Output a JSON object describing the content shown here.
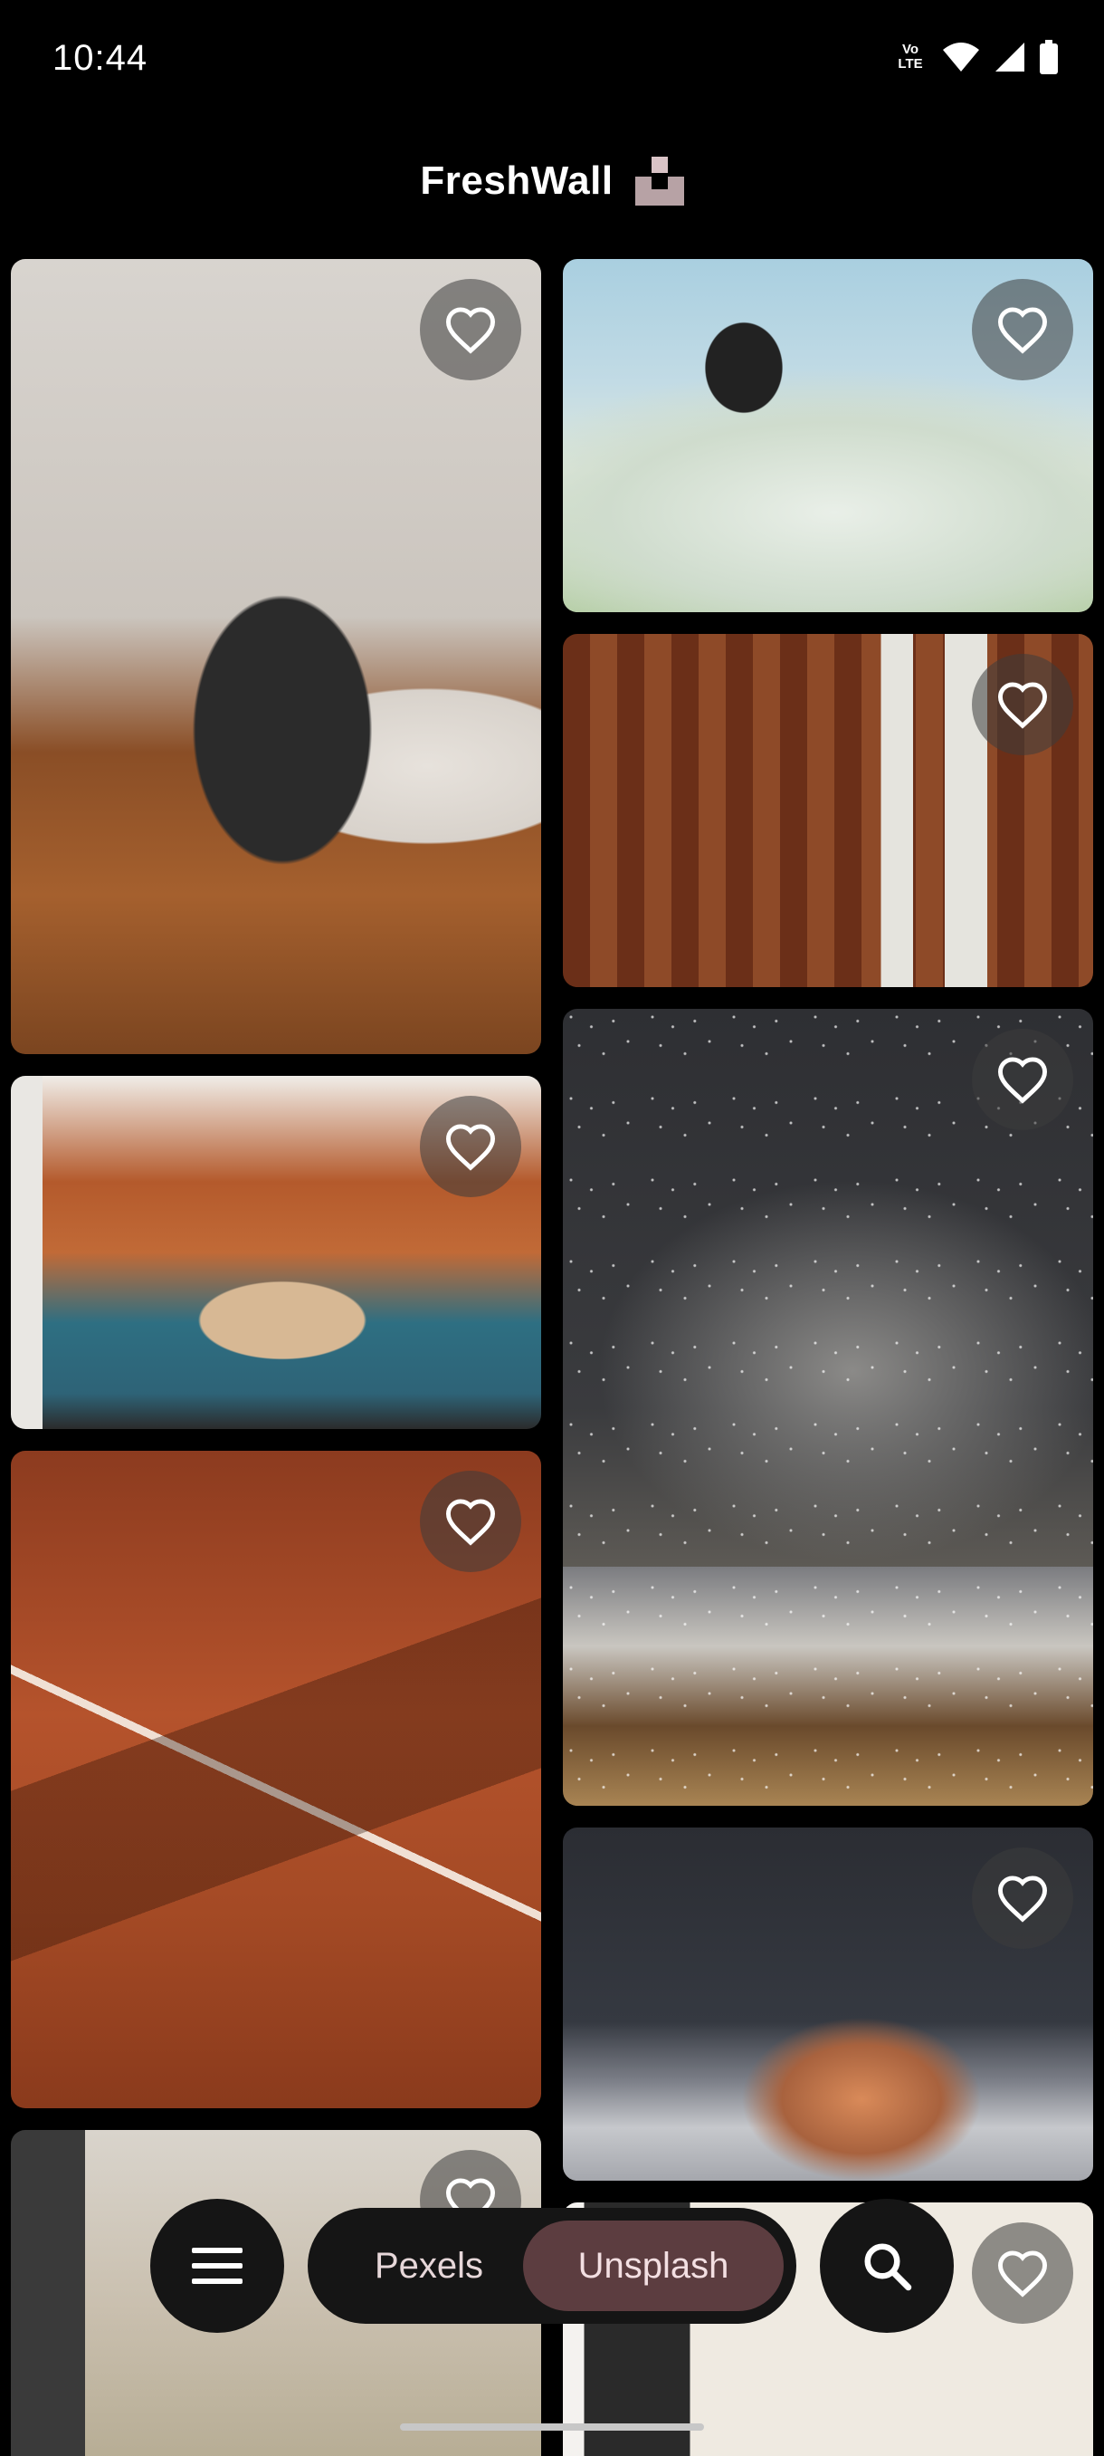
{
  "status_bar": {
    "time": "10:44",
    "volte_label": "Vo LTE",
    "icons": [
      "volte-icon",
      "wifi-icon",
      "signal-icon",
      "battery-icon"
    ]
  },
  "app": {
    "title": "FreshWall",
    "logo_icon": "freshwall-logo-icon"
  },
  "photos": [
    {
      "subject": "home-office",
      "favorite": false
    },
    {
      "subject": "puffin-flowers",
      "favorite": false
    },
    {
      "subject": "library-room",
      "favorite": false
    },
    {
      "subject": "starry-mountains",
      "favorite": false
    },
    {
      "subject": "kitchen",
      "favorite": false
    },
    {
      "subject": "clay-court-shadows",
      "favorite": false
    },
    {
      "subject": "mountain-peak-sunset",
      "favorite": false
    },
    {
      "subject": "living-room",
      "favorite": false
    },
    {
      "subject": "dining-room",
      "favorite": false
    }
  ],
  "bottom_nav": {
    "menu_icon": "menu-icon",
    "sources": [
      "Pexels",
      "Unsplash"
    ],
    "selected_source": "Unsplash",
    "search_icon": "search-icon"
  },
  "colors": {
    "background": "#000000",
    "pill": "#151515",
    "selected_tab": "#5c3d40",
    "fav_button": "rgba(60,60,60,0.55)"
  }
}
